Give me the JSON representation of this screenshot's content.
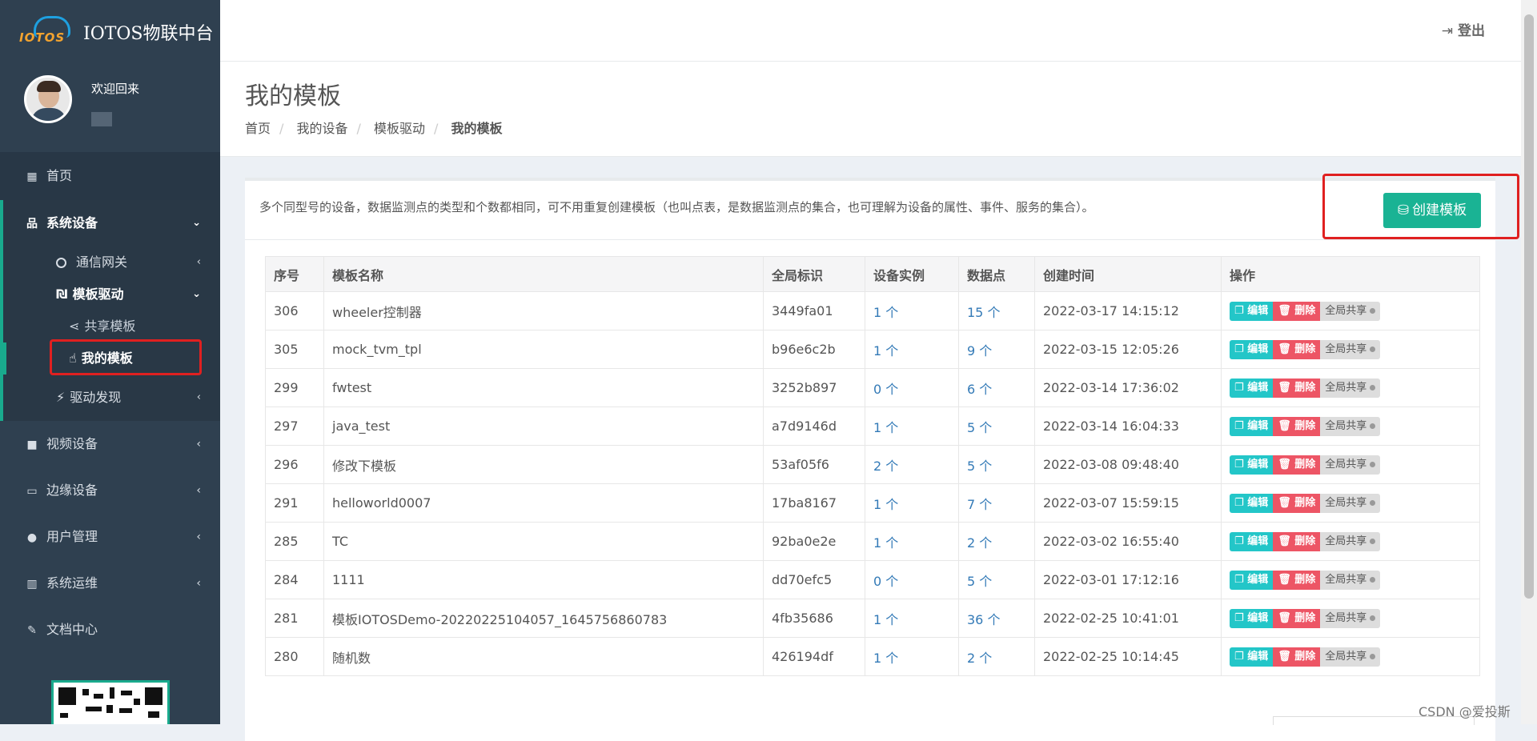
{
  "brand": {
    "logo_text": "IOTOS",
    "title": "IOTOS物联中台"
  },
  "user": {
    "welcome": "欢迎回来"
  },
  "sidebar": {
    "home": "首页",
    "system_devices": "系统设备",
    "gateway": "通信网关",
    "template_driver": "模板驱动",
    "shared_templates": "共享模板",
    "my_templates": "我的模板",
    "driver_discovery": "驱动发现",
    "video_devices": "视频设备",
    "edge_devices": "边缘设备",
    "user_management": "用户管理",
    "ops": "系统运维",
    "docs": "文档中心"
  },
  "topbar": {
    "logout": "登出"
  },
  "heading": {
    "title": "我的模板",
    "breadcrumb": [
      "首页",
      "我的设备",
      "模板驱动",
      "我的模板"
    ]
  },
  "content": {
    "description": "多个同型号的设备，数据监测点的类型和个数都相同，可不用重复创建模板（也叫点表，是数据监测点的集合，也可理解为设备的属性、事件、服务的集合）。",
    "create_button": "创建模板"
  },
  "table": {
    "headers": [
      "序号",
      "模板名称",
      "全局标识",
      "设备实例",
      "数据点",
      "创建时间",
      "操作"
    ],
    "actions": {
      "edit": "编辑",
      "delete": "删除",
      "share": "全局共享"
    },
    "rows": [
      {
        "id": "306",
        "name": "wheeler控制器",
        "gid": "3449fa01",
        "instances": "1 个",
        "points": "15 个",
        "created": "2022-03-17 14:15:12"
      },
      {
        "id": "305",
        "name": "mock_tvm_tpl",
        "gid": "b96e6c2b",
        "instances": "1 个",
        "points": "9 个",
        "created": "2022-03-15 12:05:26"
      },
      {
        "id": "299",
        "name": "fwtest",
        "gid": "3252b897",
        "instances": "0 个",
        "points": "6 个",
        "created": "2022-03-14 17:36:02"
      },
      {
        "id": "297",
        "name": "java_test",
        "gid": "a7d9146d",
        "instances": "1 个",
        "points": "5 个",
        "created": "2022-03-14 16:04:33"
      },
      {
        "id": "296",
        "name": "修改下模板",
        "gid": "53af05f6",
        "instances": "2 个",
        "points": "5 个",
        "created": "2022-03-08 09:48:40"
      },
      {
        "id": "291",
        "name": "helloworld0007",
        "gid": "17ba8167",
        "instances": "1 个",
        "points": "7 个",
        "created": "2022-03-07 15:59:15"
      },
      {
        "id": "285",
        "name": "TC",
        "gid": "92ba0e2e",
        "instances": "1 个",
        "points": "2 个",
        "created": "2022-03-02 16:55:40"
      },
      {
        "id": "284",
        "name": "1111",
        "gid": "dd70efc5",
        "instances": "0 个",
        "points": "5 个",
        "created": "2022-03-01 17:12:16"
      },
      {
        "id": "281",
        "name": "模板IOTOSDemo-20220225104057_1645756860783",
        "gid": "4fb35686",
        "instances": "1 个",
        "points": "36 个",
        "created": "2022-02-25 10:41:01"
      },
      {
        "id": "280",
        "name": "随机数",
        "gid": "426194df",
        "instances": "1 个",
        "points": "2 个",
        "created": "2022-02-25 10:14:45"
      }
    ]
  },
  "watermark": "CSDN @爱投斯",
  "colors": {
    "sidebar_bg": "#2f4050",
    "accent": "#1ab394",
    "edit": "#23c6c8",
    "delete": "#ed5565",
    "highlight": "#e02020"
  }
}
